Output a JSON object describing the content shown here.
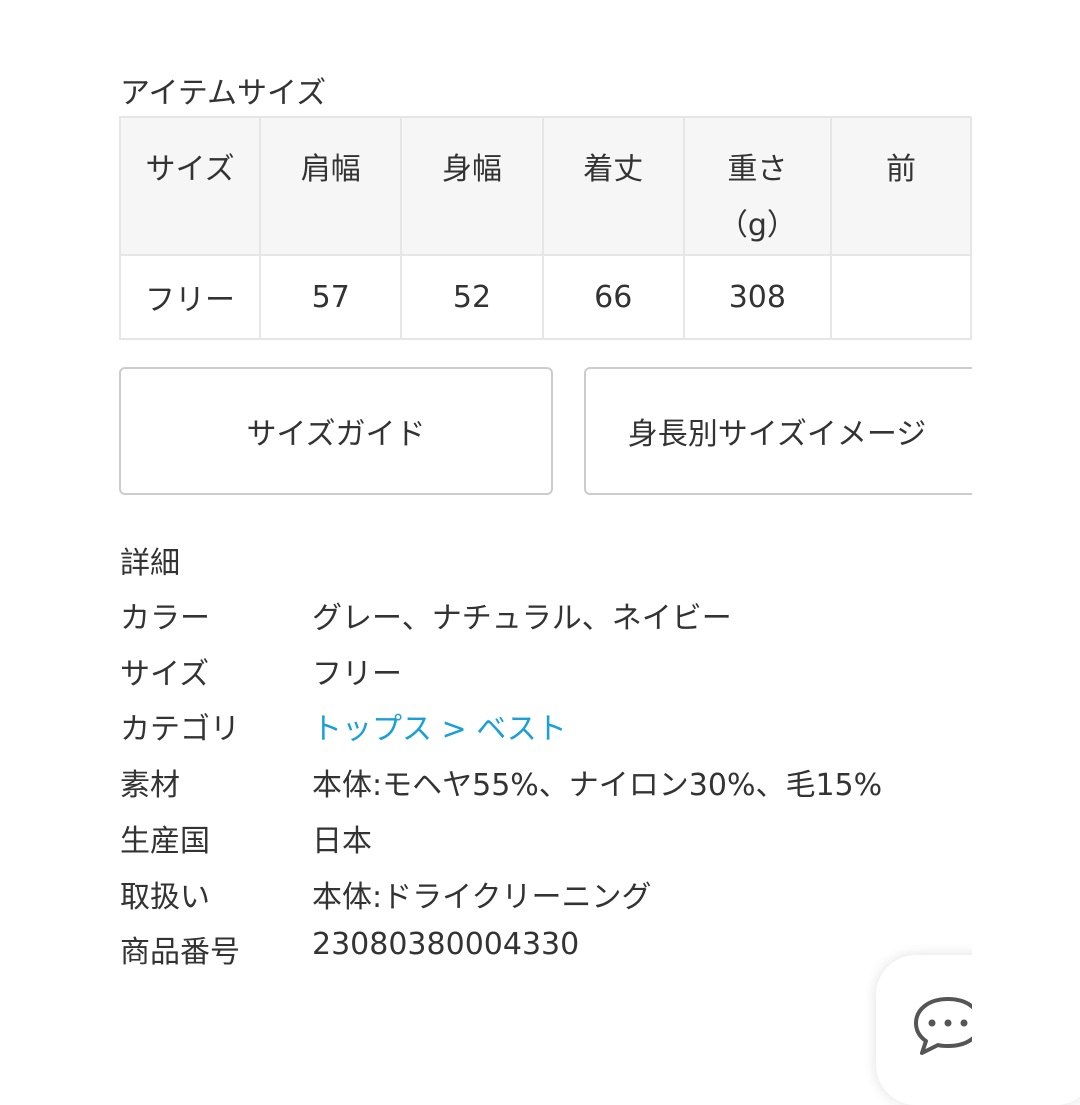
{
  "section_title": "アイテムサイズ",
  "size_table": {
    "headers": [
      "サイズ",
      "肩幅",
      "身幅",
      "着丈",
      "重さ\n（g）",
      "前"
    ],
    "rows": [
      [
        "フリー",
        "57",
        "52",
        "66",
        "308",
        ""
      ]
    ]
  },
  "buttons": {
    "size_guide": "サイズガイド",
    "height_size_image": "身長別サイズイメージ"
  },
  "details": {
    "title": "詳細",
    "rows": [
      {
        "label": "カラー",
        "value": "グレー、ナチュラル、ネイビー"
      },
      {
        "label": "サイズ",
        "value": "フリー"
      },
      {
        "label": "カテゴリ",
        "value": "トップス > ベスト",
        "link": true
      },
      {
        "label": "素材",
        "value": "本体:モヘヤ55%、ナイロン30%、毛15%"
      },
      {
        "label": "生産国",
        "value": "日本"
      },
      {
        "label": "取扱い",
        "value": "本体:ドライクリーニング"
      },
      {
        "label": "商品番号",
        "value": "23080380004330"
      }
    ]
  },
  "colors": {
    "link": "#1a9fd9"
  },
  "chat_icon": "chat-bubble-icon"
}
